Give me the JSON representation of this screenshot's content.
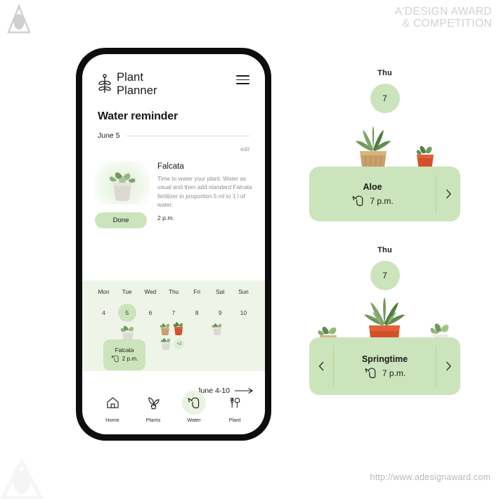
{
  "watermark": {
    "line1": "A'DESIGN AWARD",
    "line2": "& COMPETITION",
    "url": "http://www.adesignaward.com",
    "logo_icon": "a-design-award-logo-icon"
  },
  "app": {
    "brand": {
      "line1": "Plant",
      "line2": "Planner",
      "logo_icon": "sprout-logo-icon"
    },
    "menu_icon": "hamburger-menu-icon",
    "page_title": "Water reminder",
    "date_label": "June 5",
    "edit_label": "edit",
    "reminder": {
      "plant_name": "Falcata",
      "description": "Time to water your plant. Water as usual and then add standard Falcata fertilizer in proportion 5 ml to 1 l of water.",
      "time": "2 p.m.",
      "done_label": "Done",
      "thumb_icon": "potted-succulent-photo"
    },
    "calendar": {
      "days_of_week": [
        "Mon",
        "Tue",
        "Wed",
        "Thu",
        "Fri",
        "Sat",
        "Sun"
      ],
      "dates": [
        "4",
        "5",
        "6",
        "7",
        "8",
        "9",
        "10"
      ],
      "active_index": 1,
      "thursday_extra_badge": "+2",
      "tooltip": {
        "name": "Falcata",
        "time": "2 p.m.",
        "icon": "watering-can-icon"
      },
      "week_range": "June 4-10",
      "week_arrow_icon": "arrow-right-icon"
    },
    "nav": [
      {
        "label": "Home",
        "icon": "home-icon",
        "active": false
      },
      {
        "label": "Plants",
        "icon": "potted-plant-icon",
        "active": false
      },
      {
        "label": "Water",
        "icon": "watering-can-icon",
        "active": true
      },
      {
        "label": "Plant",
        "icon": "garden-tools-icon",
        "active": false
      }
    ]
  },
  "detail_cards": [
    {
      "day_of_week": "Thu",
      "day_number": "7",
      "plant_name": "Aloe",
      "time": "7 p.m.",
      "water_icon": "watering-can-icon",
      "next_icon": "chevron-right-icon",
      "has_prev": false,
      "has_next": true
    },
    {
      "day_of_week": "Thu",
      "day_number": "7",
      "plant_name": "Springtime",
      "time": "7 p.m.",
      "water_icon": "watering-can-icon",
      "prev_icon": "chevron-left-icon",
      "next_icon": "chevron-right-icon",
      "has_prev": true,
      "has_next": true
    }
  ],
  "colors": {
    "card_green": "#cce4bc",
    "strip_green": "#eef5e8",
    "accent_circle": "#cce4bc",
    "text_dark": "#1a1a1a",
    "text_muted": "#8e8e8e",
    "terracotta": "#d4502a",
    "leaf_green": "#4f7d3f"
  }
}
